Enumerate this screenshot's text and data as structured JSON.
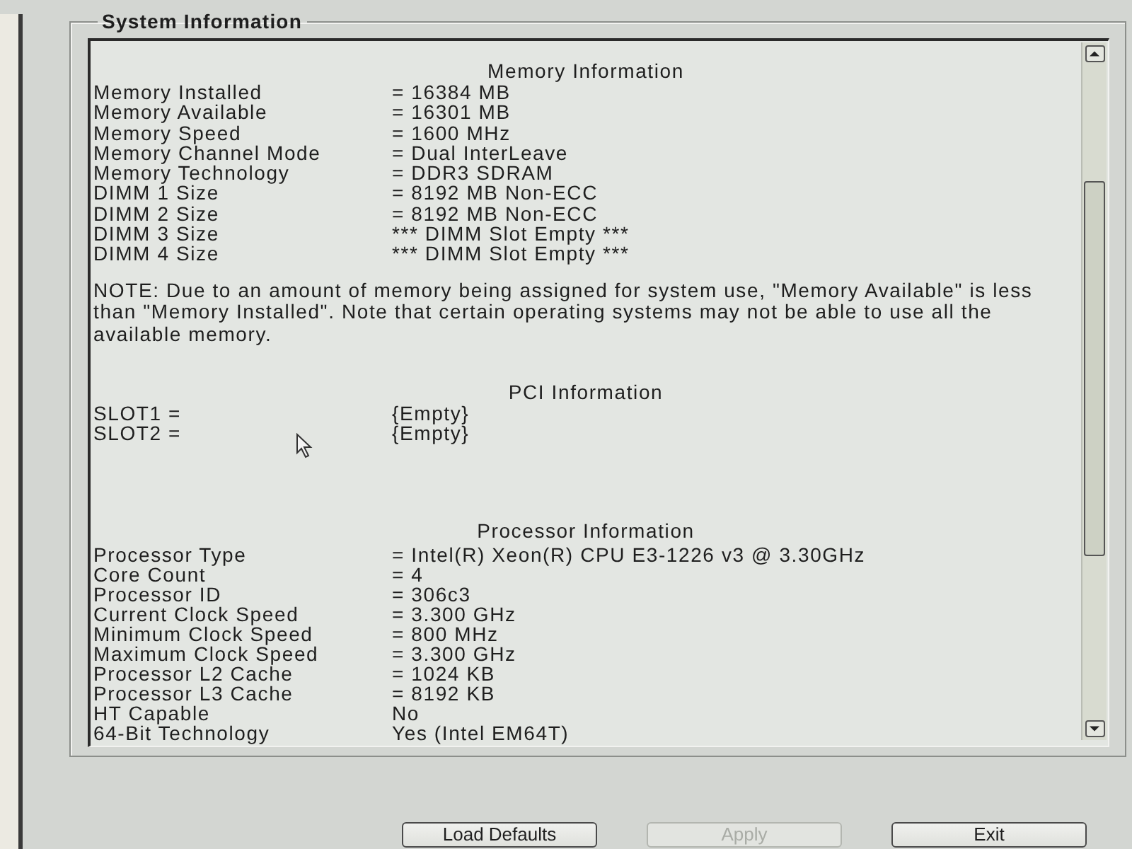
{
  "window": {
    "title": "System Information"
  },
  "sections": [
    {
      "heading": "Memory Information",
      "rows": [
        {
          "label": "Memory Installed",
          "value": "= 16384 MB"
        },
        {
          "label": "Memory Available",
          "value": "= 16301 MB"
        },
        {
          "label": "Memory Speed",
          "value": "= 1600 MHz"
        },
        {
          "label": "Memory Channel Mode",
          "value": "= Dual InterLeave"
        },
        {
          "label": "Memory Technology",
          "value": "= DDR3 SDRAM"
        },
        {
          "label": "DIMM 1 Size",
          "value": "= 8192 MB Non-ECC"
        },
        {
          "label": "DIMM 2 Size",
          "value": "= 8192 MB Non-ECC"
        },
        {
          "label": "DIMM 3 Size",
          "value": "*** DIMM Slot Empty ***"
        },
        {
          "label": "DIMM 4 Size",
          "value": "*** DIMM Slot Empty ***"
        }
      ],
      "note_lines": [
        "NOTE: Due to an amount of memory being assigned for system use, \"Memory Available\" is less",
        "than \"Memory Installed\". Note that certain operating systems may not be able to use all the",
        "available memory."
      ]
    },
    {
      "heading": "PCI Information",
      "rows": [
        {
          "label": "SLOT1 =",
          "value": "{Empty}"
        },
        {
          "label": "SLOT2 =",
          "value": "{Empty}"
        }
      ]
    },
    {
      "heading": "Processor Information",
      "rows": [
        {
          "label": "Processor Type",
          "value": "= Intel(R) Xeon(R) CPU E3-1226 v3 @ 3.30GHz"
        },
        {
          "label": "Core Count",
          "value": "= 4"
        },
        {
          "label": "Processor ID",
          "value": "= 306c3"
        },
        {
          "label": "Current Clock Speed",
          "value": "= 3.300 GHz"
        },
        {
          "label": "Minimum Clock Speed",
          "value": "= 800 MHz"
        },
        {
          "label": "Maximum Clock Speed",
          "value": "= 3.300 GHz"
        },
        {
          "label": "Processor L2 Cache",
          "value": "= 1024 KB"
        },
        {
          "label": "Processor L3 Cache",
          "value": "= 8192 KB"
        },
        {
          "label": "HT Capable",
          "value": "No"
        },
        {
          "label": "64-Bit Technology",
          "value": "Yes (Intel EM64T)"
        }
      ]
    }
  ],
  "buttons": [
    {
      "label": "Load Defaults",
      "disabled": false
    },
    {
      "label": "Apply",
      "disabled": true
    },
    {
      "label": "Exit",
      "disabled": false
    }
  ]
}
